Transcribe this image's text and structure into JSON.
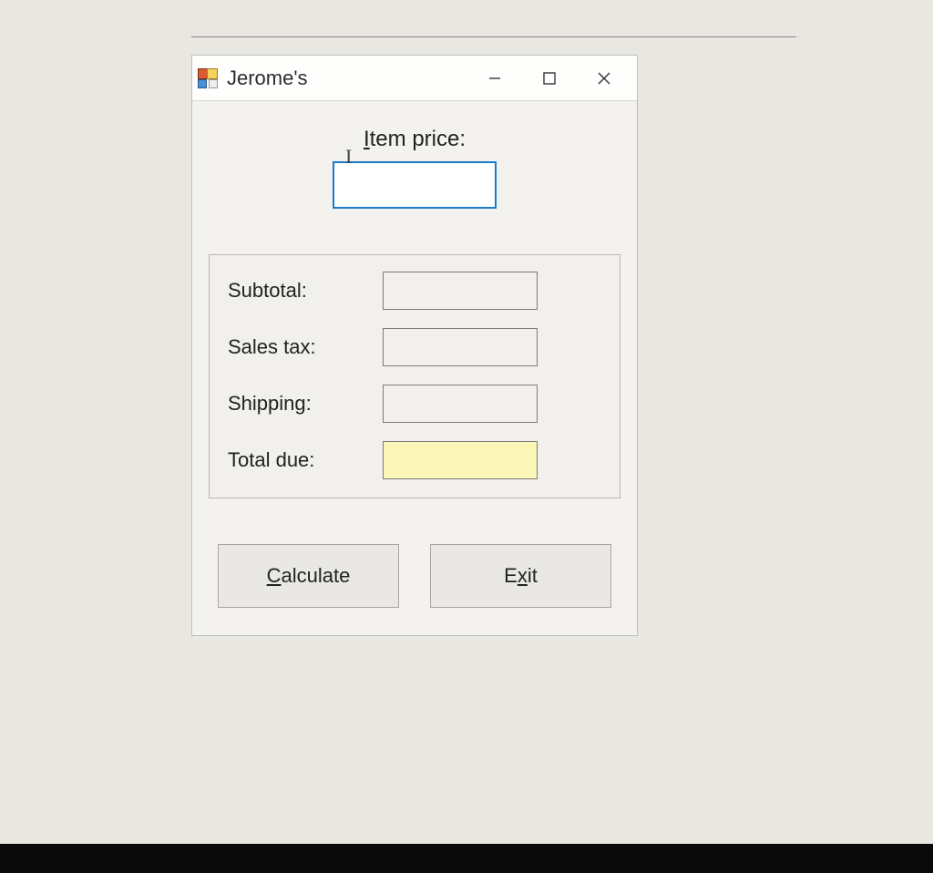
{
  "window": {
    "title": "Jerome's"
  },
  "form": {
    "item_price_label_pre": "",
    "item_price_label_ul": "I",
    "item_price_label_post": "tem price:",
    "item_price_value": ""
  },
  "outputs": {
    "subtotal_label": "Subtotal:",
    "subtotal_value": "",
    "salestax_label": "Sales tax:",
    "salestax_value": "",
    "shipping_label": "Shipping:",
    "shipping_value": "",
    "totaldue_label": "Total due:",
    "totaldue_value": ""
  },
  "buttons": {
    "calculate_ul": "C",
    "calculate_post": "alculate",
    "exit_pre": "E",
    "exit_ul": "x",
    "exit_post": "it"
  }
}
